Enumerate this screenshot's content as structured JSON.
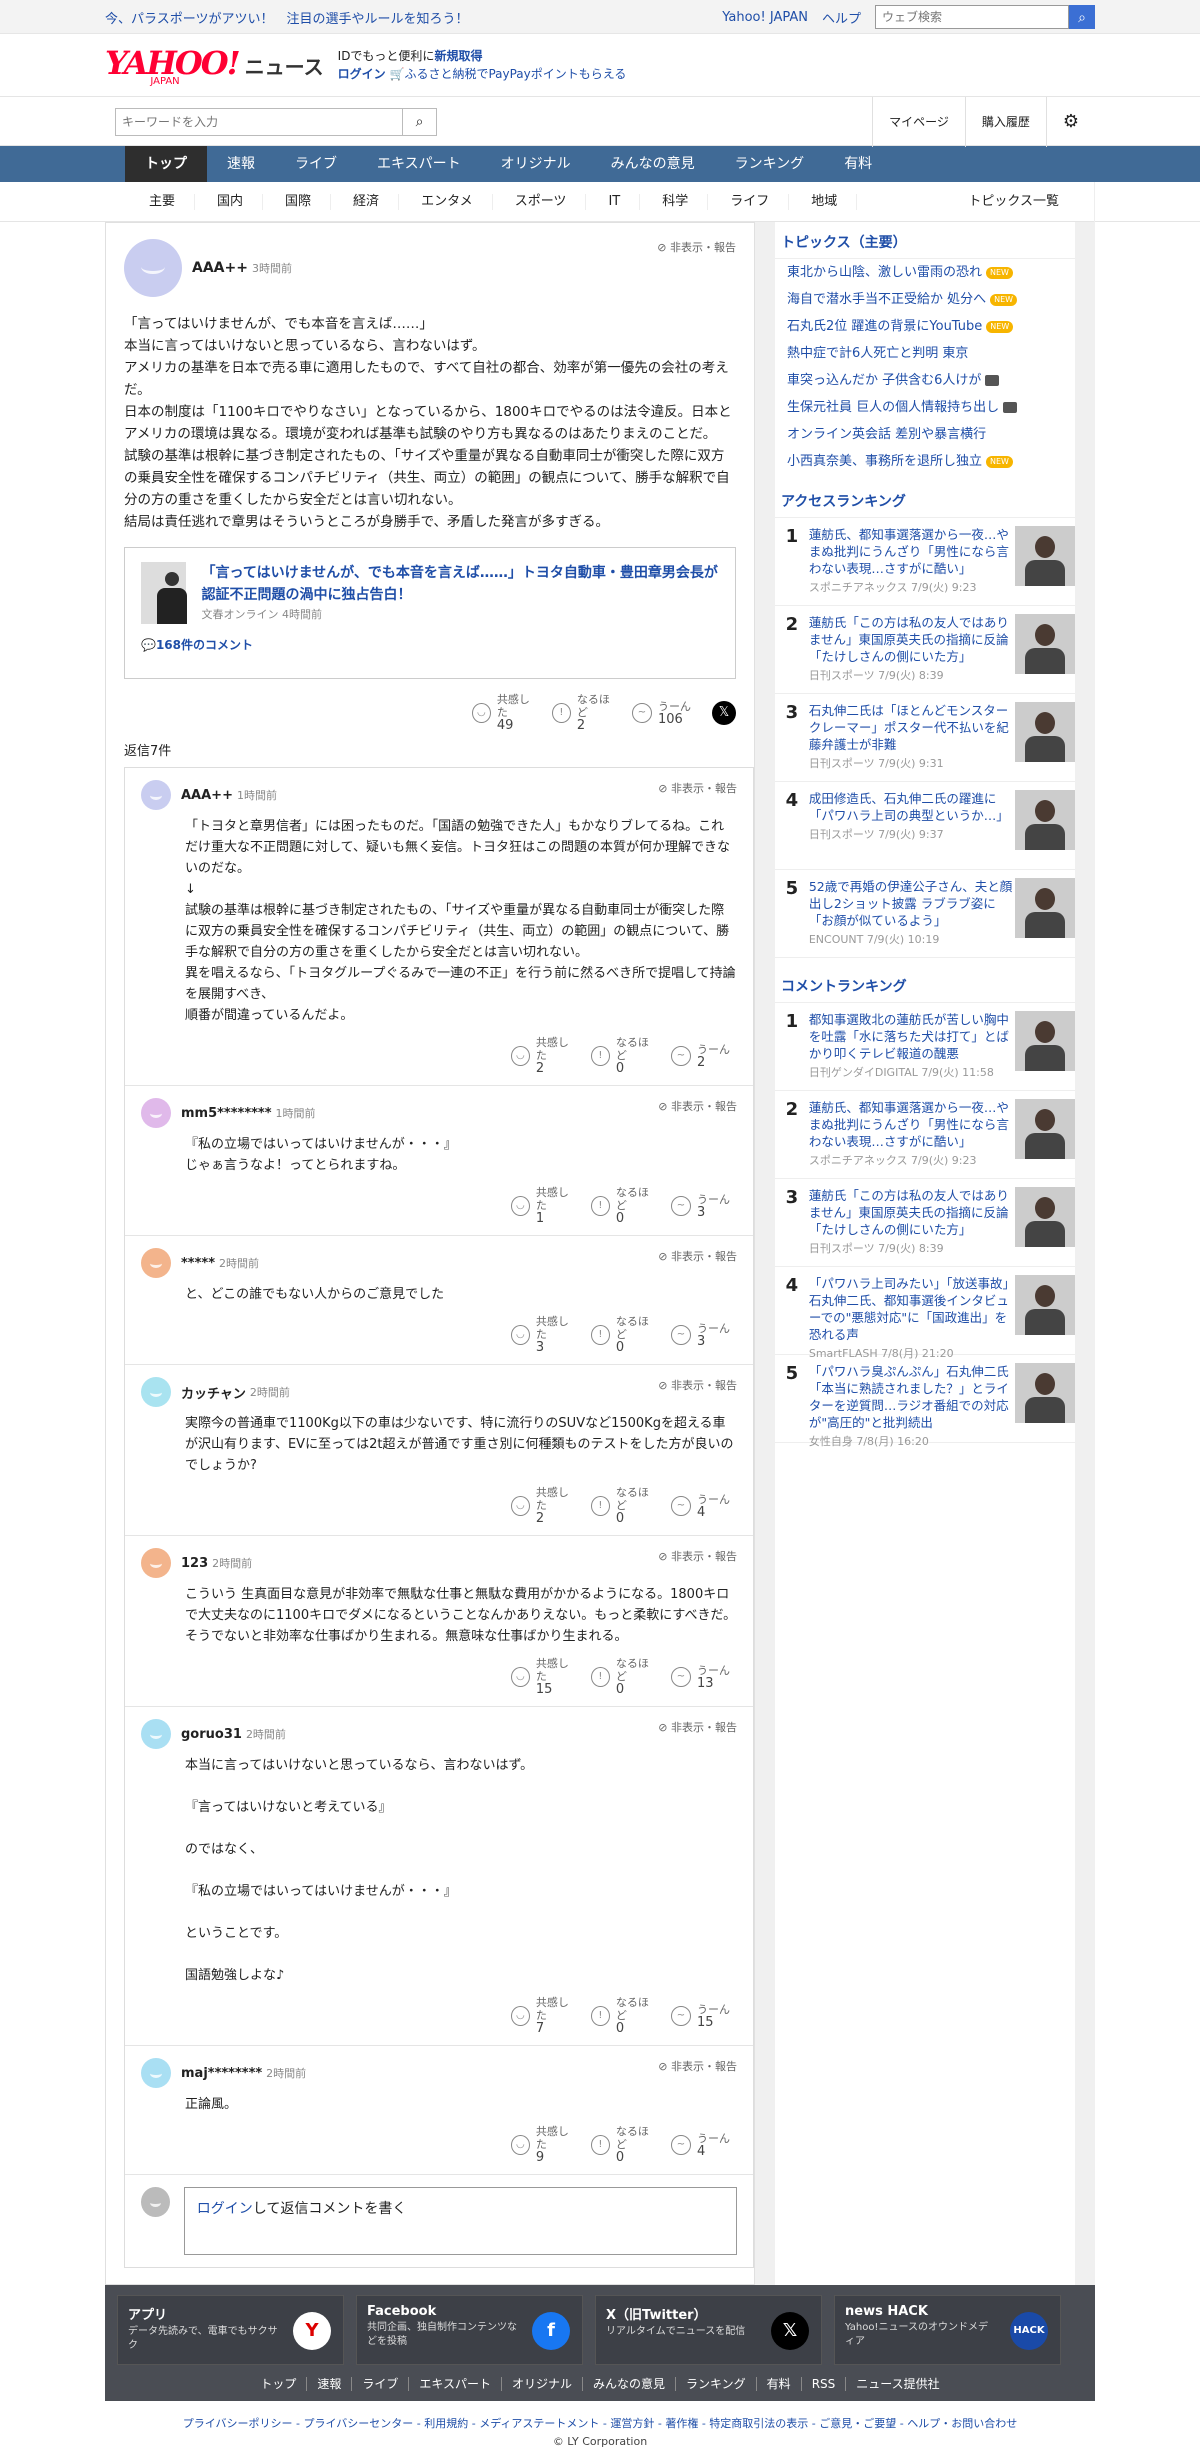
{
  "topbar": {
    "promo": "今、パラスポーツがアツい！　注目の選手やルールを知ろう！",
    "yj": "Yahoo! JAPAN",
    "help": "ヘルプ",
    "search_placeholder": "ウェブ検索"
  },
  "header": {
    "logo": "YAHOO!",
    "logo_sub": "JAPAN",
    "news": "ニュース",
    "line1": "IDでもっと便利に",
    "signup": "新規取得",
    "login": "ログイン",
    "line2": "ふるさと納税でPayPayポイントもらえる"
  },
  "search": {
    "placeholder": "キーワードを入力",
    "mypage": "マイページ",
    "history": "購入履歴"
  },
  "gnav": [
    "トップ",
    "速報",
    "ライブ",
    "エキスパート",
    "オリジナル",
    "みんなの意見",
    "ランキング",
    "有料"
  ],
  "snav": [
    "主要",
    "国内",
    "国際",
    "経済",
    "エンタメ",
    "スポーツ",
    "IT",
    "科学",
    "ライフ",
    "地域"
  ],
  "snav_all": "トピックス一覧",
  "comment": {
    "user": "AAA++",
    "time": "3時間前",
    "report": "非表示・報告",
    "text": "「言ってはいけませんが、でも本音を言えば……」\n本当に言ってはいけないと思っているなら、言わないはず。\nアメリカの基準を日本で売る車に適用したもので、すべて自社の都合、効率が第一優先の会社の考えだ。\n日本の制度は「1100キロでやりなさい」となっているから、1800キロでやるのは法令違反。日本とアメリカの環境は異なる。環境が変われば基準も試験のやり方も異なるのはあたりまえのことだ。\n試験の基準は根幹に基づき制定されたもの、「サイズや重量が異なる自動車同士が衝突した際に双方の乗員安全性を確保するコンパチビリティ（共生、両立）の範囲」の観点について、勝手な解釈で自分の方の重さを重くしたから安全だとは言い切れない。\n結局は責任逃れで章男はそういうところが身勝手で、矛盾した発言が多すぎる。",
    "card_title": "「言ってはいけませんが、でも本音を言えば……」トヨタ自動車・豊田章男会長が認証不正問題の渦中に独占告白！",
    "card_src": "文春オンライン 4時間前",
    "card_count": "168件のコメント",
    "r1": "共感した",
    "n1": "49",
    "r2": "なるほど",
    "n2": "2",
    "r3": "うーん",
    "n3": "106"
  },
  "reply_header": "返信7件",
  "replies": [
    {
      "user": "AAA++",
      "time": "1時間前",
      "text": "「トヨタと章男信者」には困ったものだ。「国語の勉強できた人」もかなりブレてるね。これだけ重大な不正問題に対して、疑いも無く妄信。トヨタ狂はこの問題の本質が何か理解できないのだな。\n↓\n試験の基準は根幹に基づき制定されたもの、「サイズや重量が異なる自動車同士が衝突した際に双方の乗員安全性を確保するコンパチビリティ（共生、両立）の範囲」の観点について、勝手な解釈で自分の方の重さを重くしたから安全だとは言い切れない。\n異を唱えるなら、「トヨタグループぐるみで一連の不正」を行う前に然るべき所で提唱して持論を展開すべき、\n順番が間違っているんだよ。",
      "n1": "2",
      "n2": "0",
      "n3": "2",
      "color": "#c9cdf0"
    },
    {
      "user": "mm5********",
      "time": "1時間前",
      "text": "『私の立場ではいってはいけませんが・・・』\nじゃぁ言うなよ！ってとられますね。",
      "n1": "1",
      "n2": "0",
      "n3": "3",
      "color": "#e0b9ea"
    },
    {
      "user": "*****",
      "time": "2時間前",
      "text": "と、どこの誰でもない人からのご意見でした",
      "n1": "3",
      "n2": "0",
      "n3": "3",
      "color": "#f3b48c"
    },
    {
      "user": "カッチャン",
      "time": "2時間前",
      "text": "実際今の普通車で1100Kg以下の車は少ないです、特に流行りのSUVなど1500Kgを超える車が沢山有ります、EVに至っては2t超えが普通です重さ別に何種類ものテストをした方が良いのでしょうか?",
      "n1": "2",
      "n2": "0",
      "n3": "4",
      "color": "#a9e3f0"
    },
    {
      "user": "123",
      "time": "2時間前",
      "text": "こういう 生真面目な意見が非効率で無駄な仕事と無駄な費用がかかるようになる。1800キロで大丈夫なのに1100キロでダメになるということなんかありえない。もっと柔軟にすべきだ。そうでないと非効率な仕事ばかり生まれる。無意味な仕事ばかり生まれる。",
      "n1": "15",
      "n2": "0",
      "n3": "13",
      "color": "#f3b48c"
    },
    {
      "user": "goruo31",
      "time": "2時間前",
      "text": "本当に言ってはいけないと思っているなら、言わないはず。\n\n『言ってはいけないと考えている』\n\nのではなく、\n\n『私の立場ではいってはいけませんが・・・』\n\nということです。\n\n国語勉強しよな♪",
      "n1": "7",
      "n2": "0",
      "n3": "15",
      "color": "#a9dff3"
    },
    {
      "user": "maj********",
      "time": "2時間前",
      "text": "正論風。",
      "n1": "9",
      "n2": "0",
      "n3": "4",
      "color": "#a9dff3"
    }
  ],
  "reply_input": {
    "login": "ログイン",
    "rest": "して返信コメントを書く"
  },
  "topics": {
    "title": "トピックス（主要）",
    "items": [
      {
        "t": "東北から山陰、激しい雷雨の恐れ",
        "b": "new"
      },
      {
        "t": "海自で潜水手当不正受給か 処分へ",
        "b": "new"
      },
      {
        "t": "石丸氏2位 躍進の背景にYouTube",
        "b": "new"
      },
      {
        "t": "熱中症で計6人死亡と判明 東京",
        "b": ""
      },
      {
        "t": "車突っ込んだか 子供含む6人けが",
        "b": "video"
      },
      {
        "t": "生保元社員 巨人の個人情報持ち出し",
        "b": "video"
      },
      {
        "t": "オンライン英会話 差別や暴言横行",
        "b": ""
      },
      {
        "t": "小西真奈美、事務所を退所し独立",
        "b": "new"
      }
    ],
    "new_label": "NEW"
  },
  "access": {
    "title": "アクセスランキング",
    "items": [
      {
        "n": "1",
        "t": "蓮舫氏、都知事選落選から一夜…やまぬ批判にうんざり「男性になら言わない表現…さすがに酷い」",
        "s": "スポニチアネックス 7/9(火) 9:23"
      },
      {
        "n": "2",
        "t": "蓮舫氏「この方は私の友人ではありません」東国原英夫氏の指摘に反論「たけしさんの側にいた方」",
        "s": "日刊スポーツ 7/9(火) 8:39"
      },
      {
        "n": "3",
        "t": "石丸伸二氏は「ほとんどモンスタークレーマー」ポスター代不払いを紀藤弁護士が非難",
        "s": "日刊スポーツ 7/9(火) 9:31"
      },
      {
        "n": "4",
        "t": "成田修造氏、石丸伸二氏の躍進に「パワハラ上司の典型というか…」",
        "s": "日刊スポーツ 7/9(火) 9:37"
      },
      {
        "n": "5",
        "t": "52歳で再婚の伊達公子さん、夫と顔出し2ショット披露 ラブラブ姿に「お顔が似ているよう」",
        "s": "ENCOUNT 7/9(火) 10:19"
      }
    ]
  },
  "comment_rank": {
    "title": "コメントランキング",
    "items": [
      {
        "n": "1",
        "t": "都知事選敗北の蓮舫氏が苦しい胸中を吐露「水に落ちた犬は打て」とばかり叩くテレビ報道の醜悪",
        "s": "日刊ゲンダイDIGITAL 7/9(火) 11:58"
      },
      {
        "n": "2",
        "t": "蓮舫氏、都知事選落選から一夜…やまぬ批判にうんざり「男性になら言わない表現…さすがに酷い」",
        "s": "スポニチアネックス 7/9(火) 9:23"
      },
      {
        "n": "3",
        "t": "蓮舫氏「この方は私の友人ではありません」東国原英夫氏の指摘に反論「たけしさんの側にいた方」",
        "s": "日刊スポーツ 7/9(火) 8:39"
      },
      {
        "n": "4",
        "t": "「パワハラ上司みたい」「放送事故」石丸伸二氏、都知事選後インタビューでの\"悪態対応\"に「国政進出」を恐れる声",
        "s": "SmartFLASH 7/8(月) 21:20"
      },
      {
        "n": "5",
        "t": "「パワハラ臭ぷんぷん」石丸伸二氏「本当に熟読されました？」とライターを逆質問…ラジオ番組での対応が\"高圧的\"と批判続出",
        "s": "女性自身 7/8(月) 16:20"
      }
    ]
  },
  "footer": {
    "cards": [
      {
        "t": "アプリ",
        "d": "データ先読みで、電車でもサクサク",
        "i": "Y"
      },
      {
        "t": "Facebook",
        "d": "共同企画、独自制作コンテンツなどを投稿",
        "i": "f"
      },
      {
        "t": "X（旧Twitter）",
        "d": "リアルタイムでニュースを配信",
        "i": "𝕏"
      },
      {
        "t": "news HACK",
        "d": "Yahoo!ニュースのオウンドメディア",
        "i": "HACK"
      }
    ],
    "links": [
      "トップ",
      "速報",
      "ライブ",
      "エキスパート",
      "オリジナル",
      "みんなの意見",
      "ランキング",
      "有料",
      "RSS",
      "ニュース提供社"
    ],
    "legal": "プライバシーポリシー - プライバシーセンター - 利用規約 - メディアステートメント - 運営方針 - 著作権 - 特定商取引法の表示 - ご意見・ご要望 - ヘルプ・お問い合わせ",
    "copy": "© LY Corporation"
  }
}
